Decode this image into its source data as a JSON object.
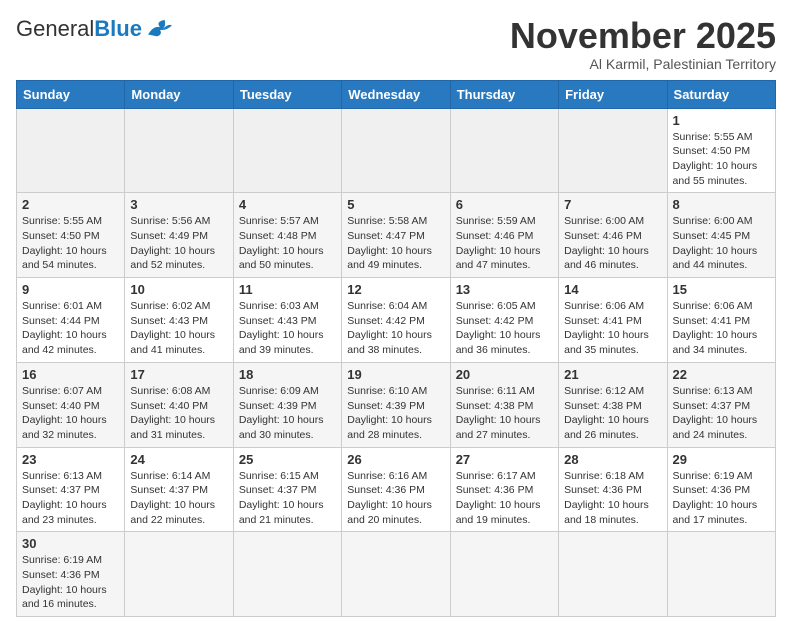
{
  "header": {
    "logo_general": "General",
    "logo_blue": "Blue",
    "month_title": "November 2025",
    "subtitle": "Al Karmil, Palestinian Territory"
  },
  "weekdays": [
    "Sunday",
    "Monday",
    "Tuesday",
    "Wednesday",
    "Thursday",
    "Friday",
    "Saturday"
  ],
  "weeks": [
    [
      {
        "day": "",
        "info": ""
      },
      {
        "day": "",
        "info": ""
      },
      {
        "day": "",
        "info": ""
      },
      {
        "day": "",
        "info": ""
      },
      {
        "day": "",
        "info": ""
      },
      {
        "day": "",
        "info": ""
      },
      {
        "day": "1",
        "info": "Sunrise: 5:55 AM\nSunset: 4:50 PM\nDaylight: 10 hours\nand 55 minutes."
      }
    ],
    [
      {
        "day": "2",
        "info": "Sunrise: 5:55 AM\nSunset: 4:50 PM\nDaylight: 10 hours\nand 54 minutes."
      },
      {
        "day": "3",
        "info": "Sunrise: 5:56 AM\nSunset: 4:49 PM\nDaylight: 10 hours\nand 52 minutes."
      },
      {
        "day": "4",
        "info": "Sunrise: 5:57 AM\nSunset: 4:48 PM\nDaylight: 10 hours\nand 50 minutes."
      },
      {
        "day": "5",
        "info": "Sunrise: 5:58 AM\nSunset: 4:47 PM\nDaylight: 10 hours\nand 49 minutes."
      },
      {
        "day": "6",
        "info": "Sunrise: 5:59 AM\nSunset: 4:46 PM\nDaylight: 10 hours\nand 47 minutes."
      },
      {
        "day": "7",
        "info": "Sunrise: 6:00 AM\nSunset: 4:46 PM\nDaylight: 10 hours\nand 46 minutes."
      },
      {
        "day": "8",
        "info": "Sunrise: 6:00 AM\nSunset: 4:45 PM\nDaylight: 10 hours\nand 44 minutes."
      }
    ],
    [
      {
        "day": "9",
        "info": "Sunrise: 6:01 AM\nSunset: 4:44 PM\nDaylight: 10 hours\nand 42 minutes."
      },
      {
        "day": "10",
        "info": "Sunrise: 6:02 AM\nSunset: 4:43 PM\nDaylight: 10 hours\nand 41 minutes."
      },
      {
        "day": "11",
        "info": "Sunrise: 6:03 AM\nSunset: 4:43 PM\nDaylight: 10 hours\nand 39 minutes."
      },
      {
        "day": "12",
        "info": "Sunrise: 6:04 AM\nSunset: 4:42 PM\nDaylight: 10 hours\nand 38 minutes."
      },
      {
        "day": "13",
        "info": "Sunrise: 6:05 AM\nSunset: 4:42 PM\nDaylight: 10 hours\nand 36 minutes."
      },
      {
        "day": "14",
        "info": "Sunrise: 6:06 AM\nSunset: 4:41 PM\nDaylight: 10 hours\nand 35 minutes."
      },
      {
        "day": "15",
        "info": "Sunrise: 6:06 AM\nSunset: 4:41 PM\nDaylight: 10 hours\nand 34 minutes."
      }
    ],
    [
      {
        "day": "16",
        "info": "Sunrise: 6:07 AM\nSunset: 4:40 PM\nDaylight: 10 hours\nand 32 minutes."
      },
      {
        "day": "17",
        "info": "Sunrise: 6:08 AM\nSunset: 4:40 PM\nDaylight: 10 hours\nand 31 minutes."
      },
      {
        "day": "18",
        "info": "Sunrise: 6:09 AM\nSunset: 4:39 PM\nDaylight: 10 hours\nand 30 minutes."
      },
      {
        "day": "19",
        "info": "Sunrise: 6:10 AM\nSunset: 4:39 PM\nDaylight: 10 hours\nand 28 minutes."
      },
      {
        "day": "20",
        "info": "Sunrise: 6:11 AM\nSunset: 4:38 PM\nDaylight: 10 hours\nand 27 minutes."
      },
      {
        "day": "21",
        "info": "Sunrise: 6:12 AM\nSunset: 4:38 PM\nDaylight: 10 hours\nand 26 minutes."
      },
      {
        "day": "22",
        "info": "Sunrise: 6:13 AM\nSunset: 4:37 PM\nDaylight: 10 hours\nand 24 minutes."
      }
    ],
    [
      {
        "day": "23",
        "info": "Sunrise: 6:13 AM\nSunset: 4:37 PM\nDaylight: 10 hours\nand 23 minutes."
      },
      {
        "day": "24",
        "info": "Sunrise: 6:14 AM\nSunset: 4:37 PM\nDaylight: 10 hours\nand 22 minutes."
      },
      {
        "day": "25",
        "info": "Sunrise: 6:15 AM\nSunset: 4:37 PM\nDaylight: 10 hours\nand 21 minutes."
      },
      {
        "day": "26",
        "info": "Sunrise: 6:16 AM\nSunset: 4:36 PM\nDaylight: 10 hours\nand 20 minutes."
      },
      {
        "day": "27",
        "info": "Sunrise: 6:17 AM\nSunset: 4:36 PM\nDaylight: 10 hours\nand 19 minutes."
      },
      {
        "day": "28",
        "info": "Sunrise: 6:18 AM\nSunset: 4:36 PM\nDaylight: 10 hours\nand 18 minutes."
      },
      {
        "day": "29",
        "info": "Sunrise: 6:19 AM\nSunset: 4:36 PM\nDaylight: 10 hours\nand 17 minutes."
      }
    ],
    [
      {
        "day": "30",
        "info": "Sunrise: 6:19 AM\nSunset: 4:36 PM\nDaylight: 10 hours\nand 16 minutes."
      },
      {
        "day": "",
        "info": ""
      },
      {
        "day": "",
        "info": ""
      },
      {
        "day": "",
        "info": ""
      },
      {
        "day": "",
        "info": ""
      },
      {
        "day": "",
        "info": ""
      },
      {
        "day": "",
        "info": ""
      }
    ]
  ]
}
